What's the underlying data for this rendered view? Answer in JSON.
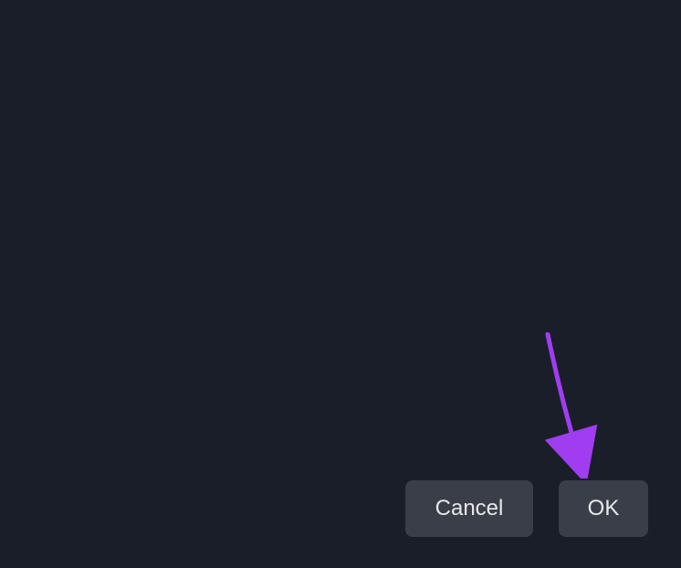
{
  "dialog": {
    "cancel_label": "Cancel",
    "ok_label": "OK"
  },
  "annotation": {
    "arrow_color": "#a03df0"
  }
}
